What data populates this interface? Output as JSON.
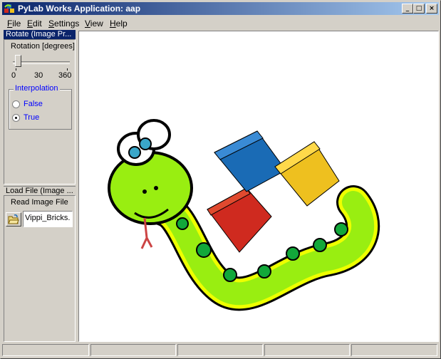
{
  "window": {
    "title": "PyLab Works Application: aap"
  },
  "titlebar_buttons": {
    "minimize": "_",
    "maximize": "□",
    "close": "×"
  },
  "menu": [
    {
      "underline": "F",
      "rest": "ile"
    },
    {
      "underline": "E",
      "rest": "dit"
    },
    {
      "underline": "S",
      "rest": "ettings"
    },
    {
      "underline": "V",
      "rest": "iew"
    },
    {
      "underline": "H",
      "rest": "elp"
    }
  ],
  "rotate_panel": {
    "caption": "Rotate (Image Pr...",
    "slider_label": "Rotation [degrees]",
    "slider": {
      "min": 0,
      "max": 360,
      "value": 0
    },
    "tick_labels": [
      "0",
      "30",
      "360"
    ],
    "interpolation": {
      "title": "Interpolation",
      "options": [
        "False",
        "True"
      ],
      "selected": "True"
    }
  },
  "load_panel": {
    "caption": "Load File (Image ...",
    "label": "Read Image File",
    "filename": "Vippi_Bricks."
  },
  "colors": {
    "title_start": "#0a246a",
    "title_end": "#a6caf0",
    "snake_green": "#99ee11",
    "brick_blue": "#1a6bb5",
    "brick_yellow": "#eec01f",
    "brick_red": "#cf2a1f"
  },
  "icons": [
    "app-icon",
    "open-folder-icon"
  ]
}
